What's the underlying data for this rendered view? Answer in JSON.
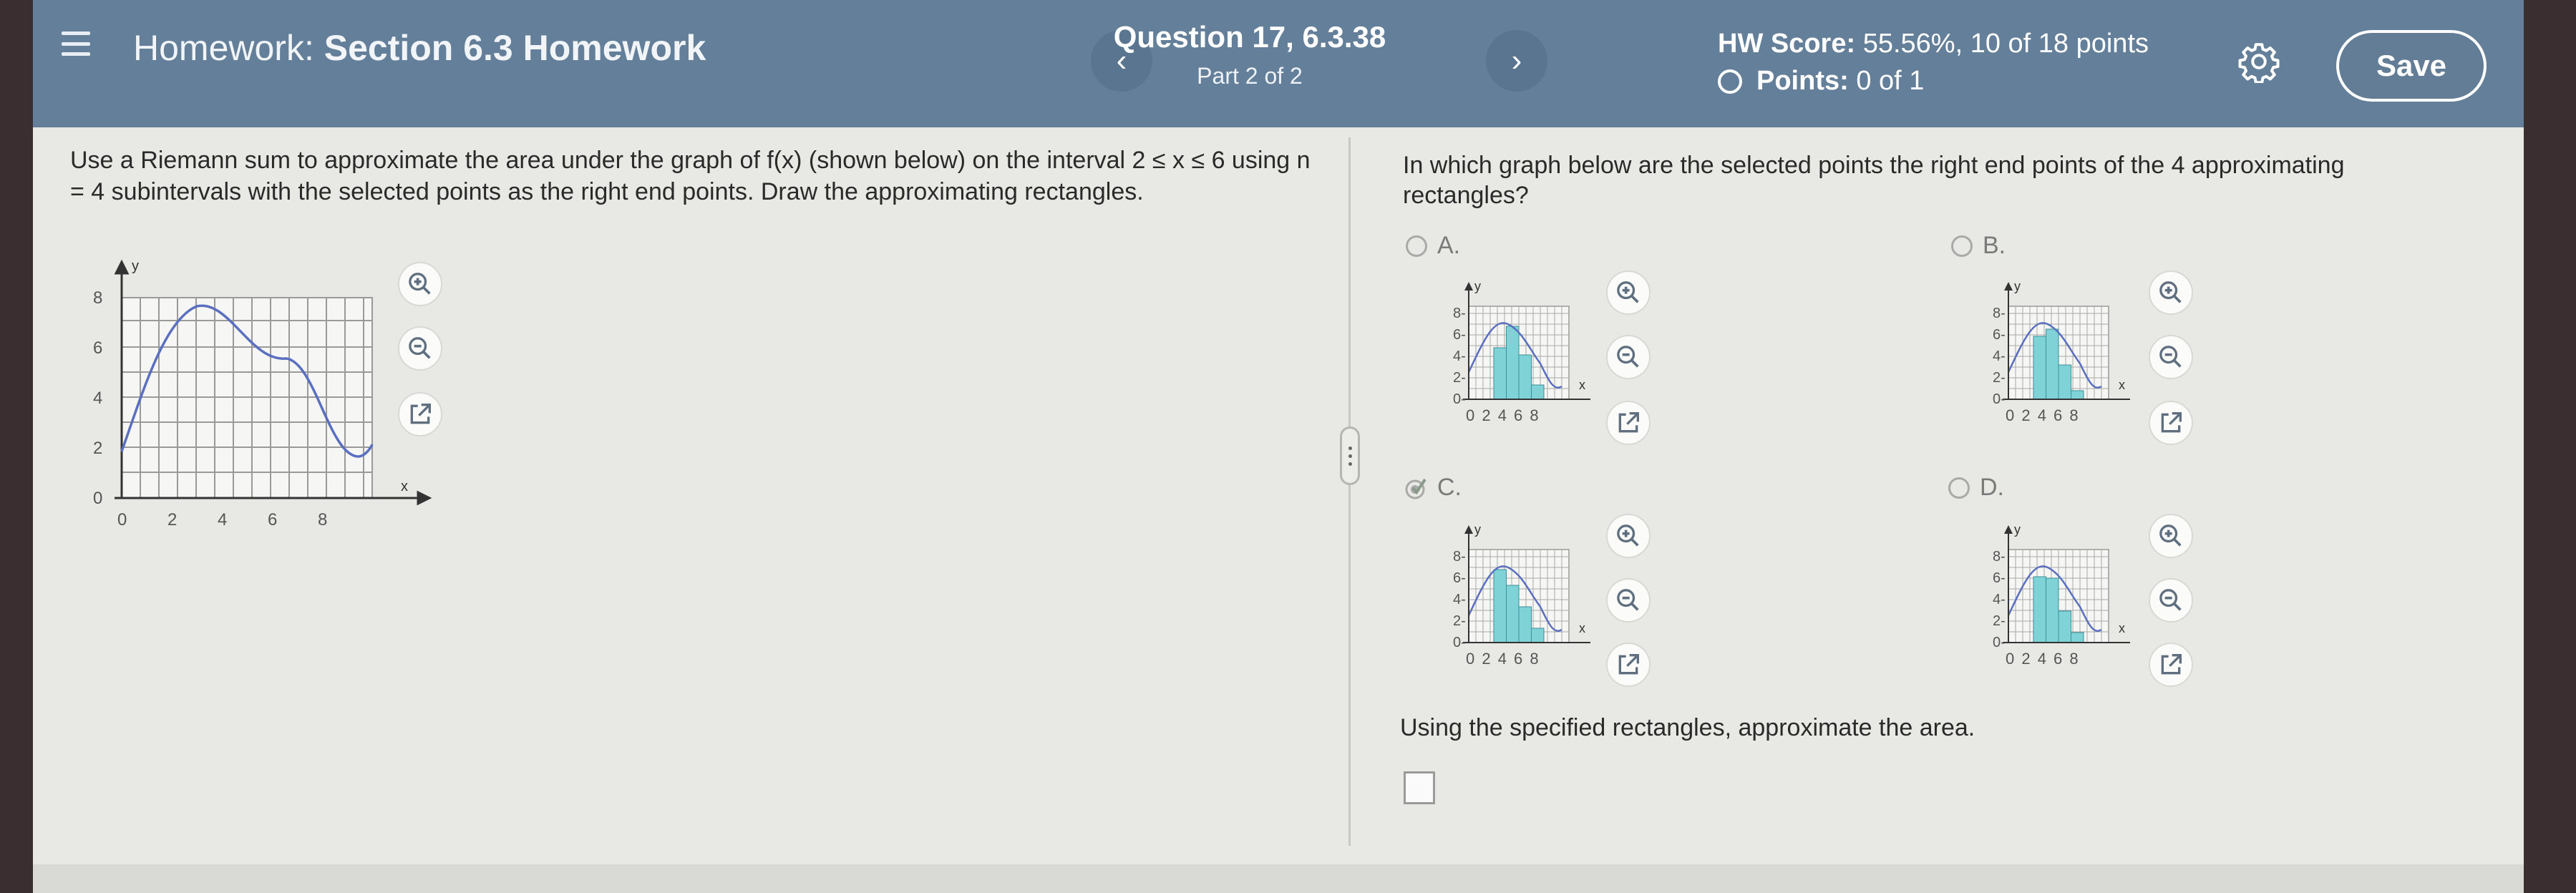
{
  "header": {
    "homework_prefix": "Homework:",
    "homework_name": "Section 6.3 Homework",
    "question_title": "Question 17, 6.3.38",
    "question_part": "Part 2 of 2",
    "prev_label": "‹",
    "next_label": "›",
    "hw_score_label": "HW Score:",
    "hw_score_value": "55.56%, 10 of 18 points",
    "points_label": "Points:",
    "points_value": "0 of 1",
    "save_label": "Save"
  },
  "left": {
    "prompt": "Use a Riemann sum to approximate the area under the graph of f(x) (shown below) on the interval 2 ≤ x ≤ 6 using n = 4 subintervals with the selected points as the right end points. Draw the approximating rectangles.",
    "graph": {
      "y_axis_label": "y",
      "x_axis_label": "x",
      "y_ticks": [
        "0",
        "2",
        "4",
        "6",
        "8"
      ],
      "x_ticks": [
        "0",
        "2",
        "4",
        "6",
        "8"
      ]
    }
  },
  "right": {
    "question": "In which graph below are the selected points the right end points of the 4 approximating rectangles?",
    "options": [
      {
        "letter": "A.",
        "selected": false
      },
      {
        "letter": "B.",
        "selected": false
      },
      {
        "letter": "C.",
        "selected": true
      },
      {
        "letter": "D.",
        "selected": false
      }
    ],
    "mini_y_ticks": [
      "8",
      "6",
      "4",
      "2",
      "0"
    ],
    "mini_x_ticks": "0 2 4 6 8",
    "mini_y_label": "y",
    "mini_x_label": "x",
    "answer_prompt": "Using the specified rectangles, approximate the area."
  },
  "colors": {
    "header_bg": "#647f99",
    "curve": "#5a6fc0",
    "rect_fill": "#7fd3d6"
  },
  "icons": [
    "menu-icon",
    "chevron-left-icon",
    "chevron-right-icon",
    "gear-icon",
    "zoom-in-icon",
    "zoom-out-icon",
    "external-link-icon",
    "checkmark-icon"
  ]
}
